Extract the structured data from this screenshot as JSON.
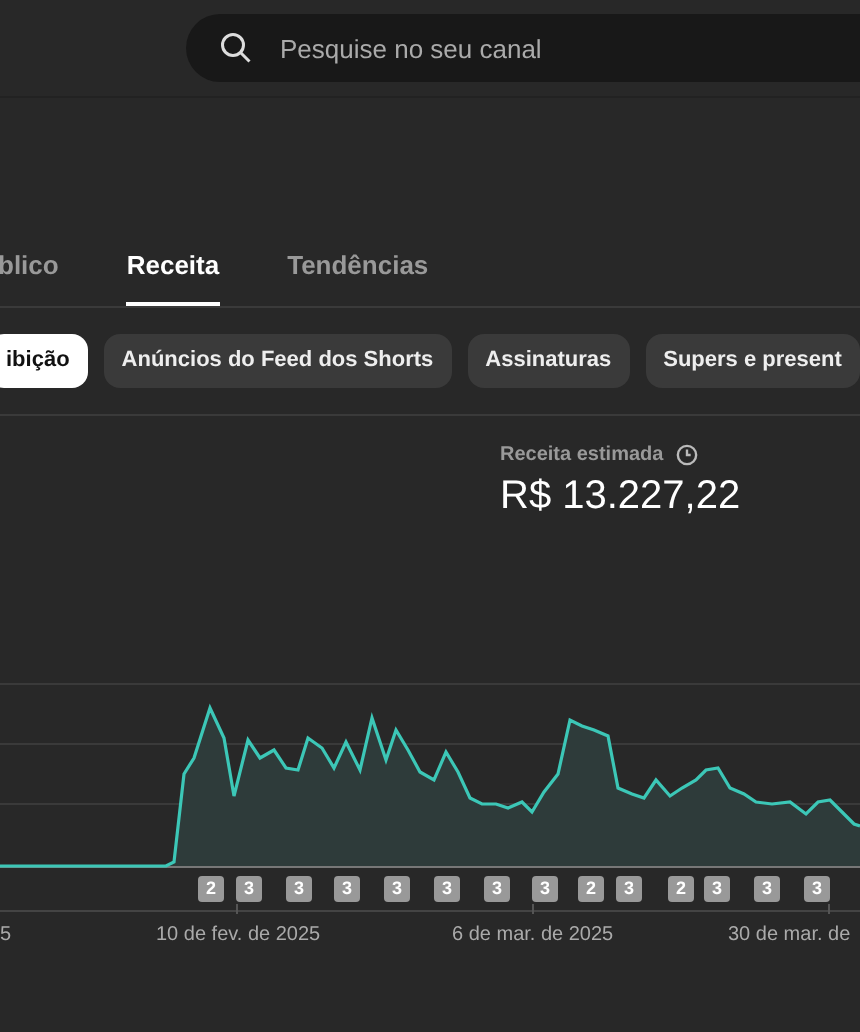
{
  "search": {
    "placeholder": "Pesquise no seu canal"
  },
  "tabs": [
    {
      "label": "blico",
      "selected": false
    },
    {
      "label": "Receita",
      "selected": true
    },
    {
      "label": "Tendências",
      "selected": false
    }
  ],
  "chips": [
    {
      "label": "ibição",
      "selected": true
    },
    {
      "label": "Anúncios do Feed dos Shorts",
      "selected": false
    },
    {
      "label": "Assinaturas",
      "selected": false
    },
    {
      "label": "Supers e present",
      "selected": false
    }
  ],
  "metric": {
    "label": "Receita estimada",
    "value": "R$ 13.227,22"
  },
  "chart": {
    "badges": [
      "2",
      "3",
      "3",
      "3",
      "3",
      "3",
      "3",
      "3",
      "2",
      "3",
      "2",
      "3",
      "3",
      "3"
    ],
    "x_labels": [
      "5",
      "10 de fev. de 2025",
      "6 de mar. de 2025",
      "30 de mar. de"
    ]
  }
}
